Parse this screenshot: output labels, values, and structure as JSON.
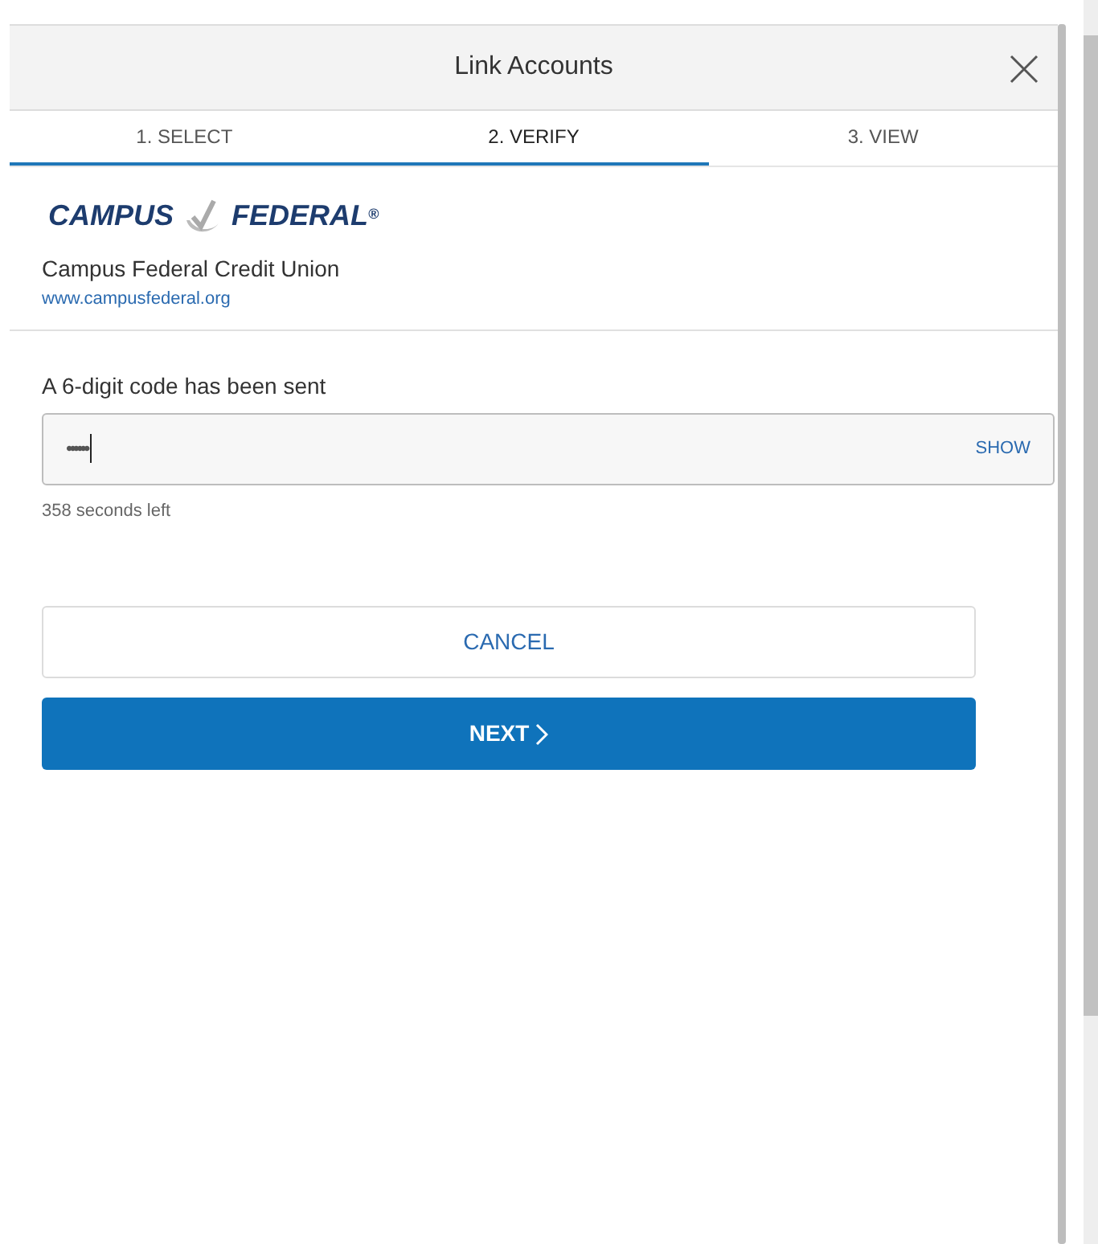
{
  "dialog": {
    "title": "Link Accounts"
  },
  "steps": [
    {
      "label": "1. SELECT",
      "selected": false
    },
    {
      "label": "2. VERIFY",
      "selected": true
    },
    {
      "label": "3. VIEW",
      "selected": false
    }
  ],
  "institution": {
    "logo_words": [
      "CAMPUS",
      "FEDERAL"
    ],
    "logo_mark": "®",
    "name": "Campus Federal Credit Union",
    "url": "www.campusfederal.org"
  },
  "code_field": {
    "label": "A 6-digit code has been sent",
    "value": "••••••",
    "toggle": "SHOW",
    "hint": "358 seconds left"
  },
  "buttons": [
    {
      "kind": "secondary",
      "label": "CANCEL"
    },
    {
      "kind": "primary",
      "label": "NEXT"
    }
  ]
}
